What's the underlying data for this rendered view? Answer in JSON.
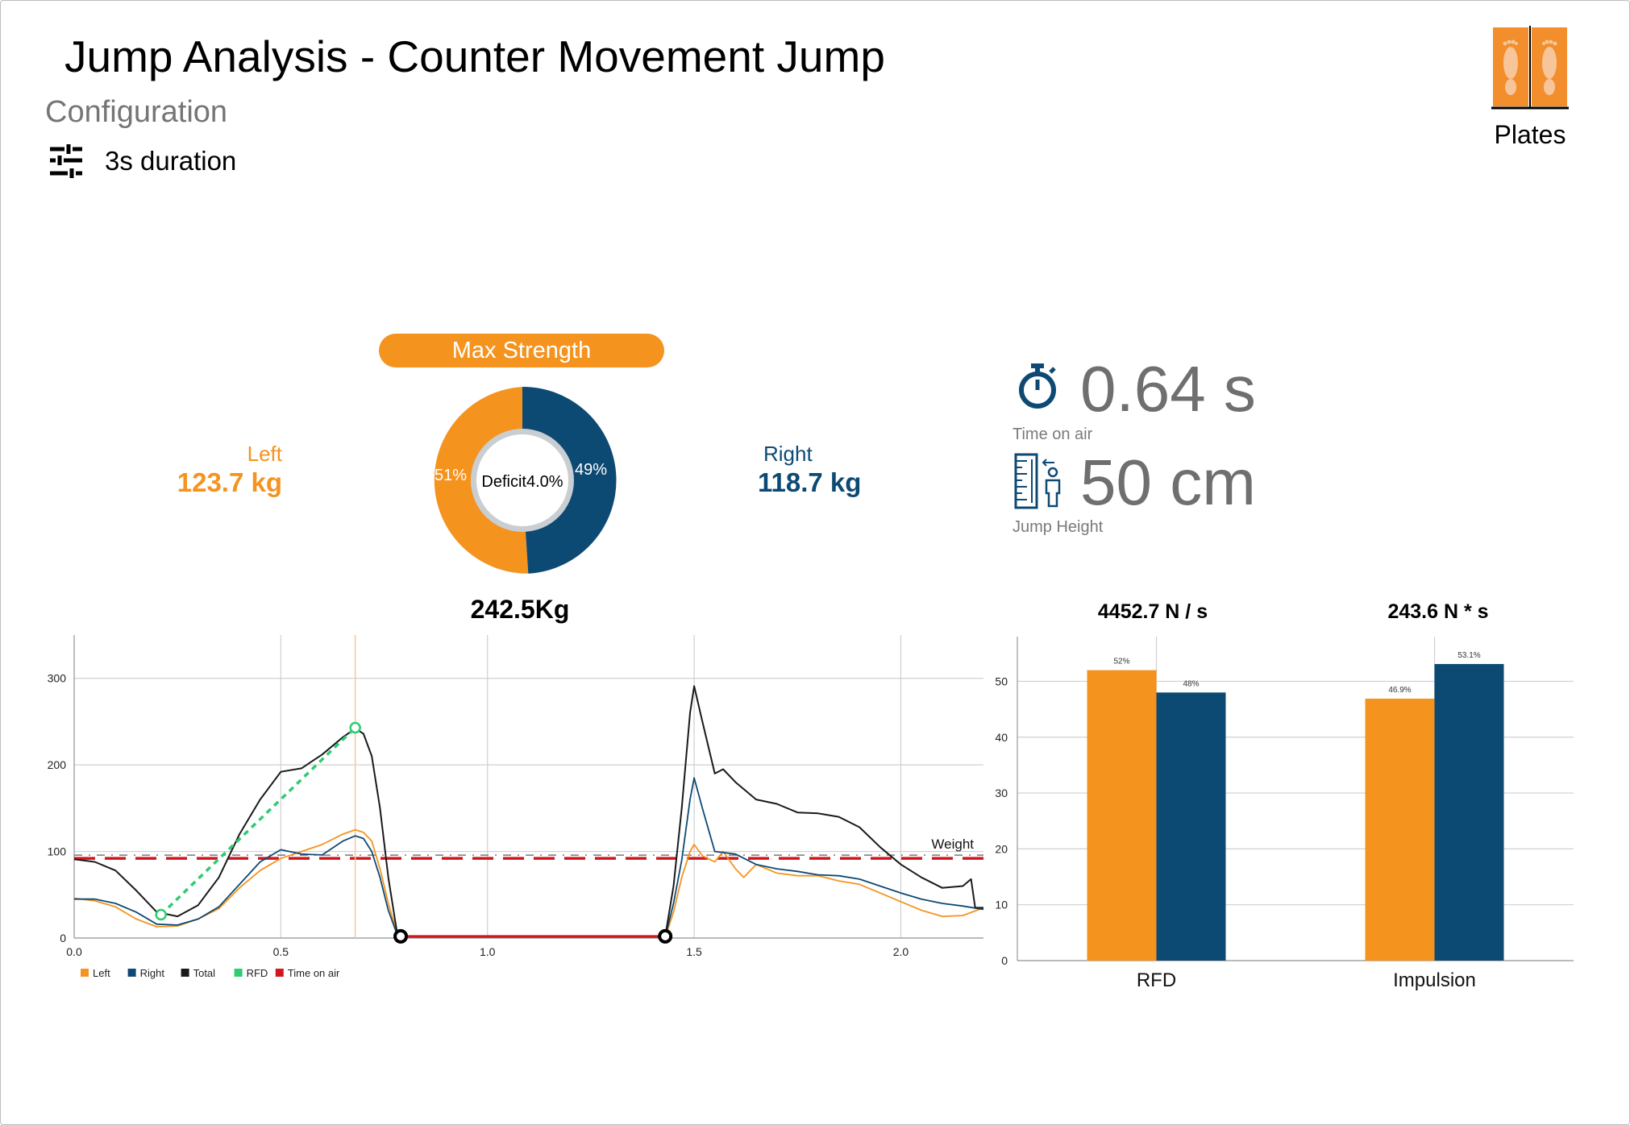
{
  "header": {
    "title": "Jump Analysis - Counter Movement Jump",
    "config_label": "Configuration",
    "duration": "3s duration",
    "plates_label": "Plates"
  },
  "max_strength": {
    "label": "Max Strength",
    "left_label": "Left",
    "left_value": "123.7 kg",
    "right_label": "Right",
    "right_value": "118.7 kg",
    "left_pct": "51%",
    "right_pct": "49%",
    "deficit": "Deficit4.0%",
    "total": "242.5Kg"
  },
  "metrics": {
    "time_on_air_value": "0.64 s",
    "time_on_air_label": "Time on air",
    "jump_height_value": "50 cm",
    "jump_height_label": "Jump Height"
  },
  "bar_headers": {
    "rfd": "4452.7 N / s",
    "impulsion": "243.6 N * s"
  },
  "colors": {
    "left": "#f5931f",
    "right": "#0d4a73",
    "total": "#1a1a1a",
    "rfd": "#2ecc71",
    "time_on_air": "#d0181e"
  },
  "chart_data": [
    {
      "type": "pie",
      "labels": [
        "Left",
        "Right"
      ],
      "values": [
        51,
        49
      ],
      "slice_labels": [
        "51%",
        "49%"
      ],
      "center_text": "Deficit4.0%",
      "title": "Max Strength"
    },
    {
      "type": "line",
      "xlim": [
        0.0,
        2.2
      ],
      "ylim": [
        0,
        350
      ],
      "x_ticks": [
        "0.0",
        "0.5",
        "1.0",
        "1.5",
        "2.0"
      ],
      "y_ticks": [
        "0",
        "100",
        "200",
        "300"
      ],
      "weight_line": {
        "label": "Weight",
        "value": 92
      },
      "legend": [
        "Left",
        "Right",
        "Total",
        "RFD",
        "Time on air"
      ],
      "series": [
        {
          "name": "Total",
          "points": [
            [
              0.0,
              91
            ],
            [
              0.05,
              88
            ],
            [
              0.1,
              78
            ],
            [
              0.15,
              55
            ],
            [
              0.2,
              30
            ],
            [
              0.25,
              25
            ],
            [
              0.3,
              38
            ],
            [
              0.35,
              70
            ],
            [
              0.4,
              120
            ],
            [
              0.45,
              160
            ],
            [
              0.5,
              192
            ],
            [
              0.55,
              196
            ],
            [
              0.6,
              212
            ],
            [
              0.65,
              232
            ],
            [
              0.68,
              242
            ],
            [
              0.7,
              236
            ],
            [
              0.72,
              210
            ],
            [
              0.74,
              150
            ],
            [
              0.76,
              70
            ],
            [
              0.78,
              10
            ],
            [
              0.79,
              2
            ],
            [
              1.43,
              2
            ],
            [
              1.45,
              60
            ],
            [
              1.47,
              150
            ],
            [
              1.49,
              260
            ],
            [
              1.5,
              291
            ],
            [
              1.52,
              250
            ],
            [
              1.55,
              190
            ],
            [
              1.57,
              195
            ],
            [
              1.6,
              180
            ],
            [
              1.65,
              160
            ],
            [
              1.7,
              155
            ],
            [
              1.75,
              145
            ],
            [
              1.8,
              144
            ],
            [
              1.85,
              140
            ],
            [
              1.9,
              128
            ],
            [
              1.95,
              105
            ],
            [
              2.0,
              85
            ],
            [
              2.05,
              70
            ],
            [
              2.1,
              58
            ],
            [
              2.15,
              60
            ],
            [
              2.17,
              68
            ],
            [
              2.18,
              35
            ],
            [
              2.2,
              35
            ]
          ]
        },
        {
          "name": "Left",
          "points": [
            [
              0.0,
              46
            ],
            [
              0.05,
              43
            ],
            [
              0.1,
              36
            ],
            [
              0.15,
              22
            ],
            [
              0.2,
              13
            ],
            [
              0.25,
              14
            ],
            [
              0.3,
              22
            ],
            [
              0.35,
              34
            ],
            [
              0.4,
              58
            ],
            [
              0.45,
              78
            ],
            [
              0.5,
              92
            ],
            [
              0.55,
              100
            ],
            [
              0.6,
              108
            ],
            [
              0.65,
              120
            ],
            [
              0.68,
              125
            ],
            [
              0.7,
              122
            ],
            [
              0.72,
              112
            ],
            [
              0.74,
              80
            ],
            [
              0.76,
              40
            ],
            [
              0.78,
              8
            ],
            [
              0.79,
              1
            ],
            [
              1.43,
              1
            ],
            [
              1.45,
              30
            ],
            [
              1.47,
              70
            ],
            [
              1.49,
              100
            ],
            [
              1.5,
              108
            ],
            [
              1.52,
              95
            ],
            [
              1.55,
              88
            ],
            [
              1.57,
              100
            ],
            [
              1.6,
              80
            ],
            [
              1.62,
              70
            ],
            [
              1.65,
              85
            ],
            [
              1.7,
              75
            ],
            [
              1.75,
              72
            ],
            [
              1.8,
              72
            ],
            [
              1.85,
              66
            ],
            [
              1.9,
              62
            ],
            [
              1.95,
              52
            ],
            [
              2.0,
              42
            ],
            [
              2.05,
              32
            ],
            [
              2.1,
              25
            ],
            [
              2.15,
              26
            ],
            [
              2.2,
              35
            ]
          ]
        },
        {
          "name": "Right",
          "points": [
            [
              0.0,
              45
            ],
            [
              0.05,
              45
            ],
            [
              0.1,
              40
            ],
            [
              0.15,
              30
            ],
            [
              0.2,
              16
            ],
            [
              0.25,
              15
            ],
            [
              0.3,
              22
            ],
            [
              0.35,
              36
            ],
            [
              0.4,
              62
            ],
            [
              0.45,
              88
            ],
            [
              0.5,
              102
            ],
            [
              0.55,
              97
            ],
            [
              0.6,
              96
            ],
            [
              0.65,
              112
            ],
            [
              0.68,
              118
            ],
            [
              0.7,
              115
            ],
            [
              0.72,
              100
            ],
            [
              0.74,
              70
            ],
            [
              0.76,
              32
            ],
            [
              0.78,
              6
            ],
            [
              0.79,
              1
            ],
            [
              1.43,
              1
            ],
            [
              1.45,
              40
            ],
            [
              1.47,
              90
            ],
            [
              1.49,
              160
            ],
            [
              1.5,
              185
            ],
            [
              1.52,
              150
            ],
            [
              1.55,
              100
            ],
            [
              1.6,
              97
            ],
            [
              1.65,
              85
            ],
            [
              1.7,
              80
            ],
            [
              1.75,
              77
            ],
            [
              1.8,
              73
            ],
            [
              1.85,
              72
            ],
            [
              1.9,
              68
            ],
            [
              1.95,
              60
            ],
            [
              2.0,
              52
            ],
            [
              2.05,
              45
            ],
            [
              2.1,
              40
            ],
            [
              2.15,
              37
            ],
            [
              2.2,
              33
            ]
          ]
        },
        {
          "name": "RFD",
          "points": [
            [
              0.21,
              27
            ],
            [
              0.68,
              243
            ]
          ]
        },
        {
          "name": "Time on air",
          "points": [
            [
              0.79,
              2
            ],
            [
              1.43,
              2
            ]
          ]
        }
      ]
    },
    {
      "type": "bar",
      "categories": [
        "RFD",
        "Impulsion"
      ],
      "ylim": [
        0,
        58
      ],
      "y_ticks": [
        "0",
        "10",
        "20",
        "30",
        "40",
        "50"
      ],
      "series": [
        {
          "name": "Left",
          "values": [
            52,
            46.9
          ],
          "labels": [
            "52%",
            "46.9%"
          ]
        },
        {
          "name": "Right",
          "values": [
            48,
            53.1
          ],
          "labels": [
            "48%",
            "53.1%"
          ]
        }
      ]
    }
  ]
}
